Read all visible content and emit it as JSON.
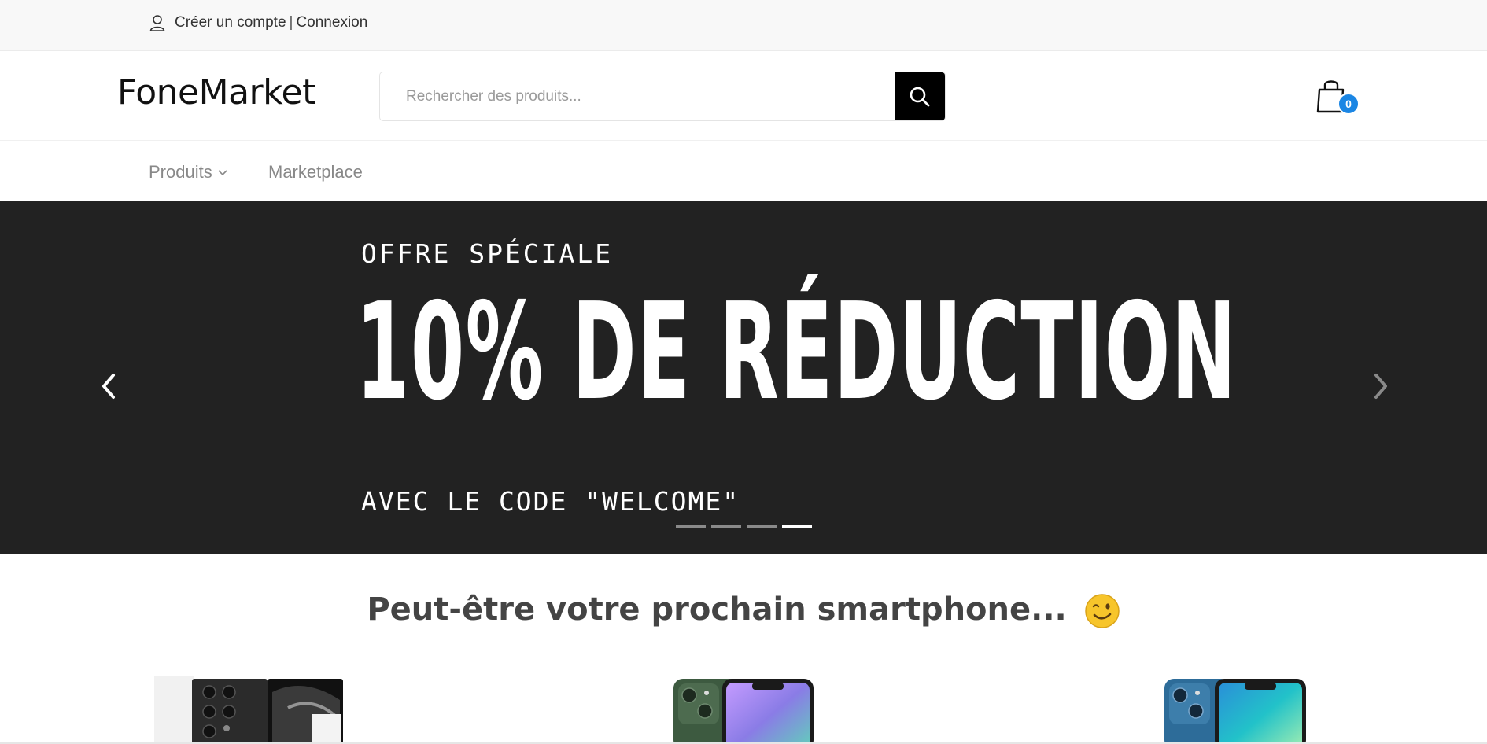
{
  "topbar": {
    "create_account": "Créer un compte",
    "separator": "|",
    "login": "Connexion"
  },
  "header": {
    "logo": "FoneMarket",
    "search_placeholder": "Rechercher des produits...",
    "cart_count": "0"
  },
  "nav": {
    "items": [
      {
        "label": "Produits",
        "has_dropdown": true
      },
      {
        "label": "Marketplace",
        "has_dropdown": false
      }
    ]
  },
  "hero": {
    "eyebrow": "OFFRE SPÉCIALE",
    "headline": "10% DE RÉDUCTION",
    "code_line": "AVEC LE CODE \"WELCOME\"",
    "slide_count": 4,
    "active_slide": 4
  },
  "section": {
    "title": "Peut-être votre prochain smartphone..."
  },
  "colors": {
    "hero_bg": "#222222",
    "badge": "#1b86e4",
    "search_button": "#000000",
    "topbar_bg": "#f8f8f8"
  },
  "icons": [
    "user-icon",
    "search-icon",
    "shopping-bag-icon",
    "chevron-down-icon",
    "chevron-left-icon",
    "chevron-right-icon",
    "wink-emoji-icon"
  ]
}
